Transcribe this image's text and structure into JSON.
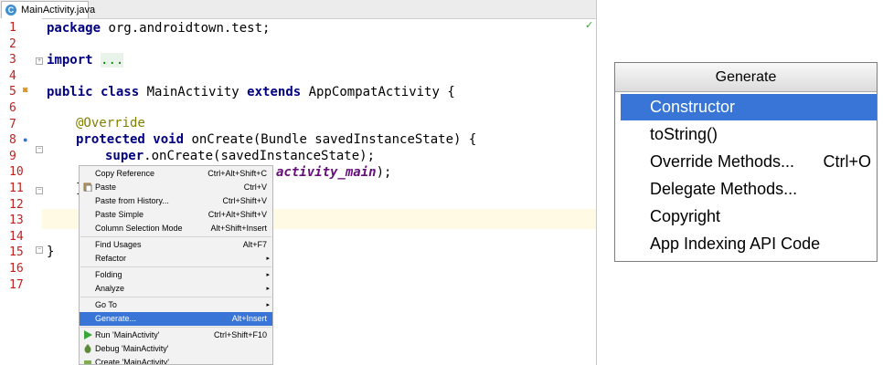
{
  "editor": {
    "tab_label": "MainActivity.java",
    "tab_icon_glyph": "C",
    "line_numbers": [
      "1",
      "2",
      "3",
      "4",
      "5",
      "6",
      "7",
      "8",
      "9",
      "10",
      "11",
      "12",
      "13",
      "14",
      "15",
      "16",
      "17"
    ],
    "code": {
      "l1_kw": "package",
      "l1_rest": " org.androidtown.test;",
      "l3_kw": "import",
      "l3_fold": "...",
      "l6_kw1": "public class",
      "l6_mid": " MainActivity ",
      "l6_kw2": "extends",
      "l6_rest": " AppCompatActivity {",
      "l8_ann": "@Override",
      "l9_kw": "protected void",
      "l9_rest": " onCreate(Bundle savedInstanceState) {",
      "l10_kw": "super",
      "l10_rest": ".onCreate(savedInstanceState);",
      "l11_field": "activity_main",
      "l11_rest": ");",
      "l12_text": "}",
      "l16_text": "}"
    }
  },
  "context_menu": {
    "items": [
      {
        "label": "Copy Reference",
        "shortcut": "Ctrl+Alt+Shift+C"
      },
      {
        "label": "Paste",
        "shortcut": "Ctrl+V"
      },
      {
        "label": "Paste from History...",
        "shortcut": "Ctrl+Shift+V"
      },
      {
        "label": "Paste Simple",
        "shortcut": "Ctrl+Alt+Shift+V"
      },
      {
        "label": "Column Selection Mode",
        "shortcut": "Alt+Shift+Insert"
      },
      {
        "label": "Find Usages",
        "shortcut": "Alt+F7"
      },
      {
        "label": "Refactor",
        "shortcut": ""
      },
      {
        "label": "Folding",
        "shortcut": ""
      },
      {
        "label": "Analyze",
        "shortcut": ""
      },
      {
        "label": "Go To",
        "shortcut": ""
      },
      {
        "label": "Generate...",
        "shortcut": "Alt+Insert"
      },
      {
        "label": "Run 'MainActivity'",
        "shortcut": "Ctrl+Shift+F10"
      },
      {
        "label": "Debug 'MainActivity'",
        "shortcut": ""
      },
      {
        "label": "Create 'MainActivity'...",
        "shortcut": ""
      }
    ],
    "selected": "Generate...",
    "submenu_arrow": "▸"
  },
  "generate_popup": {
    "title": "Generate",
    "items": [
      {
        "label": "Constructor",
        "shortcut": ""
      },
      {
        "label": "toString()",
        "shortcut": ""
      },
      {
        "label": "Override Methods...",
        "shortcut": "Ctrl+O"
      },
      {
        "label": "Delegate Methods...",
        "shortcut": ""
      },
      {
        "label": "Copyright",
        "shortcut": ""
      },
      {
        "label": "App Indexing API Code",
        "shortcut": ""
      }
    ],
    "selected": "Constructor"
  },
  "colors": {
    "selection": "#3875d7",
    "keyword": "#000080",
    "annotation": "#808000",
    "line_number": "#c02222",
    "current_line": "#fffae3"
  },
  "icons": [
    "java-class-icon",
    "paste-icon",
    "run-icon",
    "debug-icon",
    "create-icon",
    "inspection-ok-icon"
  ]
}
